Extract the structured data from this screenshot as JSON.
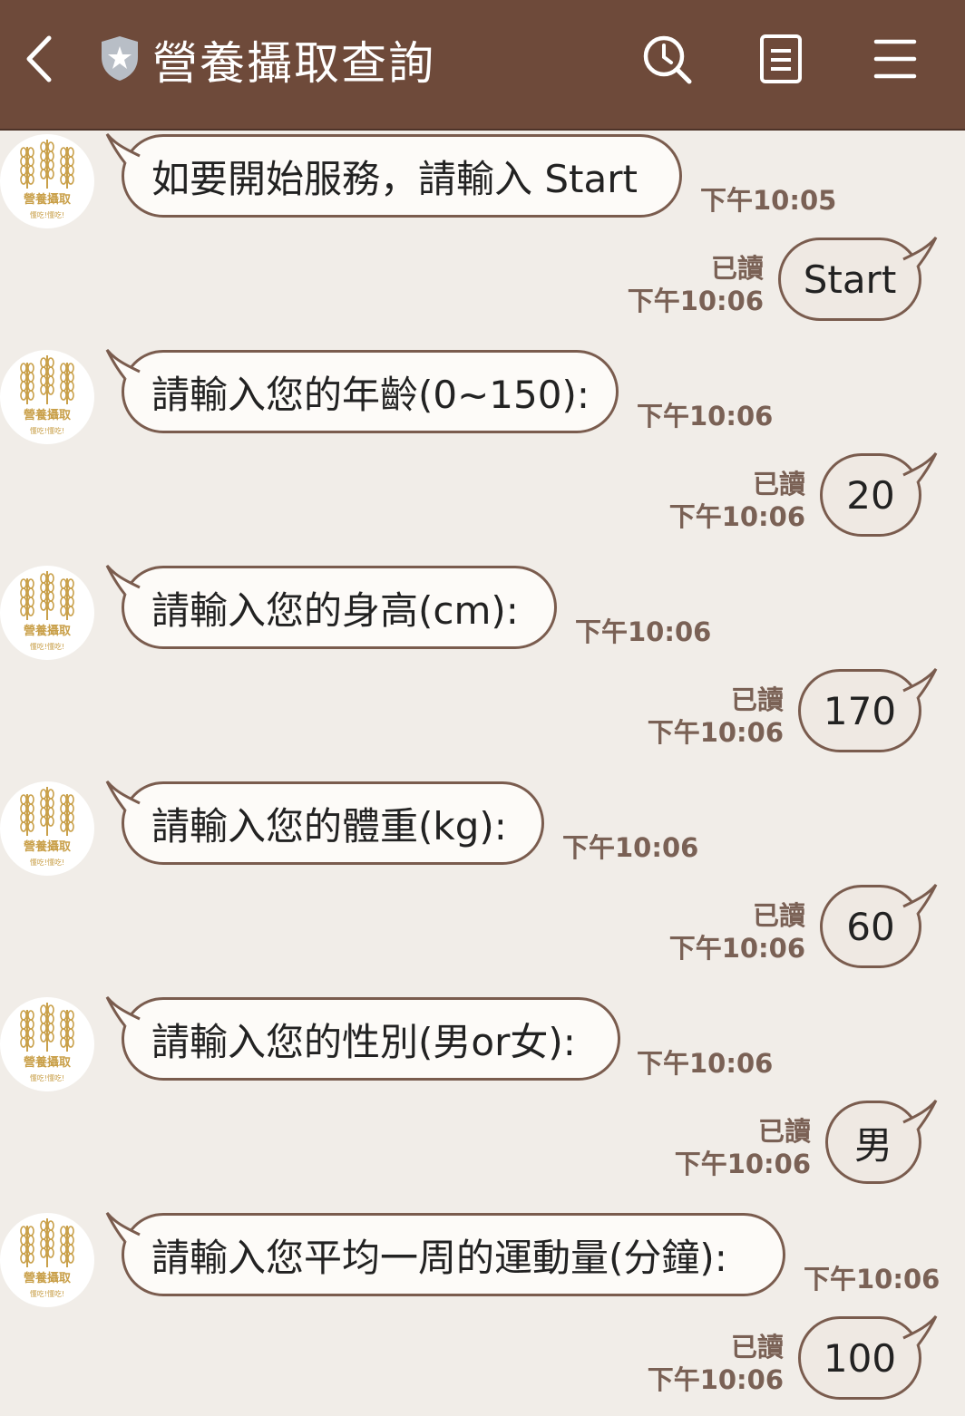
{
  "header": {
    "title": "營養攝取查詢",
    "icons": [
      "back-arrow-icon",
      "shield-star-icon",
      "search-clock-icon",
      "notes-icon",
      "menu-icon"
    ]
  },
  "bot": {
    "logo_text": "營養攝取",
    "logo_subtext": "懂吃!懂吃!"
  },
  "messages": [
    {
      "from": "bot",
      "text": "如要開始服務，請輸入 Start",
      "time": "下午10:05"
    },
    {
      "from": "user",
      "text": "Start",
      "read": "已讀",
      "time": "下午10:06"
    },
    {
      "from": "bot",
      "text": "請輸入您的年齡(0~150):",
      "time": "下午10:06"
    },
    {
      "from": "user",
      "text": "20",
      "read": "已讀",
      "time": "下午10:06"
    },
    {
      "from": "bot",
      "text": "請輸入您的身高(cm):",
      "time": "下午10:06"
    },
    {
      "from": "user",
      "text": "170",
      "read": "已讀",
      "time": "下午10:06"
    },
    {
      "from": "bot",
      "text": "請輸入您的體重(kg):",
      "time": "下午10:06"
    },
    {
      "from": "user",
      "text": "60",
      "read": "已讀",
      "time": "下午10:06"
    },
    {
      "from": "bot",
      "text": "請輸入您的性別(男or女):",
      "time": "下午10:06"
    },
    {
      "from": "user",
      "text": "男",
      "read": "已讀",
      "time": "下午10:06"
    },
    {
      "from": "bot",
      "text": "請輸入您平均一周的運動量(分鐘):",
      "time": "下午10:06"
    },
    {
      "from": "user",
      "text": "100",
      "read": "已讀",
      "time": "下午10:06"
    }
  ],
  "colors": {
    "header_bg": "#6e4a3a",
    "chat_bg": "#f1ede8",
    "bubble_border": "#7a5c4e",
    "timestamp": "#7a6155",
    "logo_gold": "#c9a04a"
  }
}
